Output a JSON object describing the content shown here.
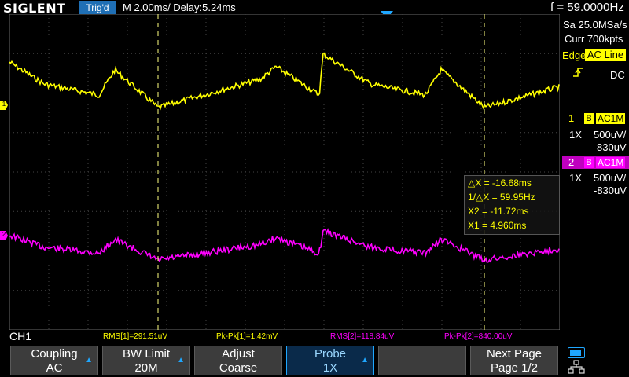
{
  "topbar": {
    "brand": "SIGLENT",
    "trigger_status": "Trig'd",
    "timebase": "M 2.00ms/ Delay:5.24ms",
    "frequency": "f = 59.0000Hz"
  },
  "acquisition": {
    "sample_rate": "Sa 25.0MSa/s",
    "memory_depth": "Curr 700kpts"
  },
  "trigger": {
    "type_label": "Edge",
    "source": "AC Line",
    "slope_icon": "rising-edge-icon",
    "coupling": "DC"
  },
  "channels": [
    {
      "num": "1",
      "bw": "B",
      "coupling": "AC1M",
      "probe": "1X",
      "scale": "500uV/",
      "offset": "830uV",
      "color": "#ffff00"
    },
    {
      "num": "2",
      "bw": "B",
      "coupling": "AC1M",
      "probe": "1X",
      "scale": "500uV/",
      "offset": "-830uV",
      "color": "#ff00ff"
    }
  ],
  "cursors": {
    "delta_x": "△X = -16.68ms",
    "inv_delta_x": "1/△X = 59.95Hz",
    "x2": "X2 = -11.72ms",
    "x1": "X1 = 4.960ms"
  },
  "measurements": {
    "active_channel": "CH1",
    "items": [
      {
        "label": "RMS[1]=291.51uV",
        "color": "#ffff00"
      },
      {
        "label": "Pk-Pk[1]=1.42mV",
        "color": "#ffff00"
      },
      {
        "label": "RMS[2]=118.84uV",
        "color": "#ff00ff"
      },
      {
        "label": "Pk-Pk[2]=840.00uV",
        "color": "#ff00ff"
      }
    ]
  },
  "softmenu": [
    {
      "line1": "Coupling",
      "line2": "AC",
      "arrow": true
    },
    {
      "line1": "BW Limit",
      "line2": "20M",
      "arrow": true
    },
    {
      "line1": "Adjust",
      "line2": "Coarse",
      "arrow": false
    },
    {
      "line1": "Probe",
      "line2": "1X",
      "arrow": true
    },
    {
      "line1": "",
      "line2": "",
      "arrow": false
    },
    {
      "line1": "Next Page",
      "line2": "Page 1/2",
      "arrow": false
    }
  ],
  "waveform_markers": {
    "ch1": "1",
    "ch2": "2"
  },
  "colors": {
    "ch1": "#ffff00",
    "ch2": "#ff00ff",
    "cursor": "#ffff80",
    "accent": "#1fa7ff"
  }
}
